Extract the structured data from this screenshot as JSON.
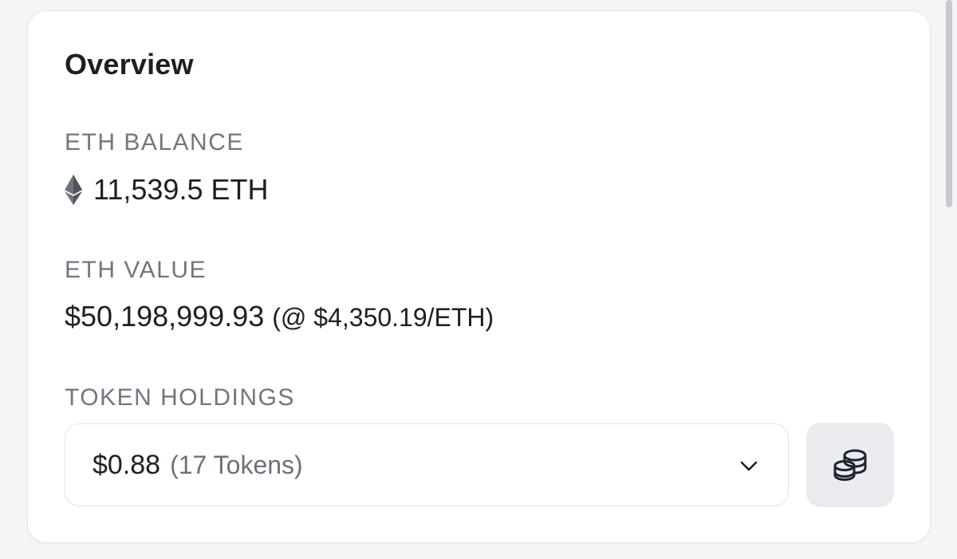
{
  "overview": {
    "title": "Overview",
    "eth_balance_label": "ETH BALANCE",
    "eth_balance": "11,539.5 ETH",
    "eth_value_label": "ETH VALUE",
    "eth_value": "$50,198,999.93",
    "eth_price": "(@ $4,350.19/ETH)",
    "token_holdings_label": "TOKEN HOLDINGS",
    "token_holdings_value": "$0.88",
    "token_holdings_count": "(17 Tokens)"
  },
  "icons": {
    "eth": "ethereum-diamond-icon",
    "chevron": "chevron-down-icon",
    "coins": "coins-stack-icon"
  },
  "colors": {
    "text_primary": "#1c1f24",
    "text_muted": "#707680",
    "button_bg": "#e9ebee",
    "page_bg": "#f4f5f7"
  }
}
